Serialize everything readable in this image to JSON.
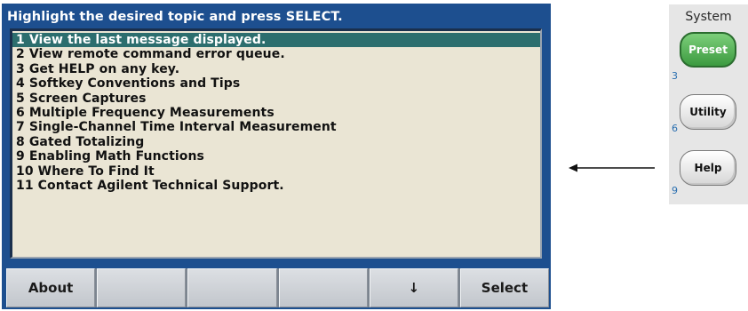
{
  "screen": {
    "title": "Highlight the desired topic and press SELECT.",
    "topics": [
      "1 View the last message displayed.",
      "2 View remote command error queue.",
      "3 Get HELP on any key.",
      "4 Softkey Conventions and Tips",
      "5 Screen Captures",
      "6 Multiple Frequency Measurements",
      "7 Single-Channel Time Interval Measurement",
      "8 Gated Totalizing",
      "9 Enabling Math Functions",
      "10 Where To Find It",
      "11 Contact Agilent Technical Support."
    ],
    "selected_index": 0
  },
  "softkeys": [
    "About",
    "",
    "",
    "",
    "↓",
    "Select"
  ],
  "front_panel": {
    "group_label": "System",
    "keys": [
      {
        "label": "Preset",
        "number": "3"
      },
      {
        "label": "Utility",
        "number": "6"
      },
      {
        "label": "Help",
        "number": "9"
      }
    ]
  },
  "colors": {
    "screen_bg": "#1d4f8f",
    "panel_bg": "#eae5d4",
    "highlight": "#2c6e6e",
    "preset_key": "#4caf50"
  }
}
